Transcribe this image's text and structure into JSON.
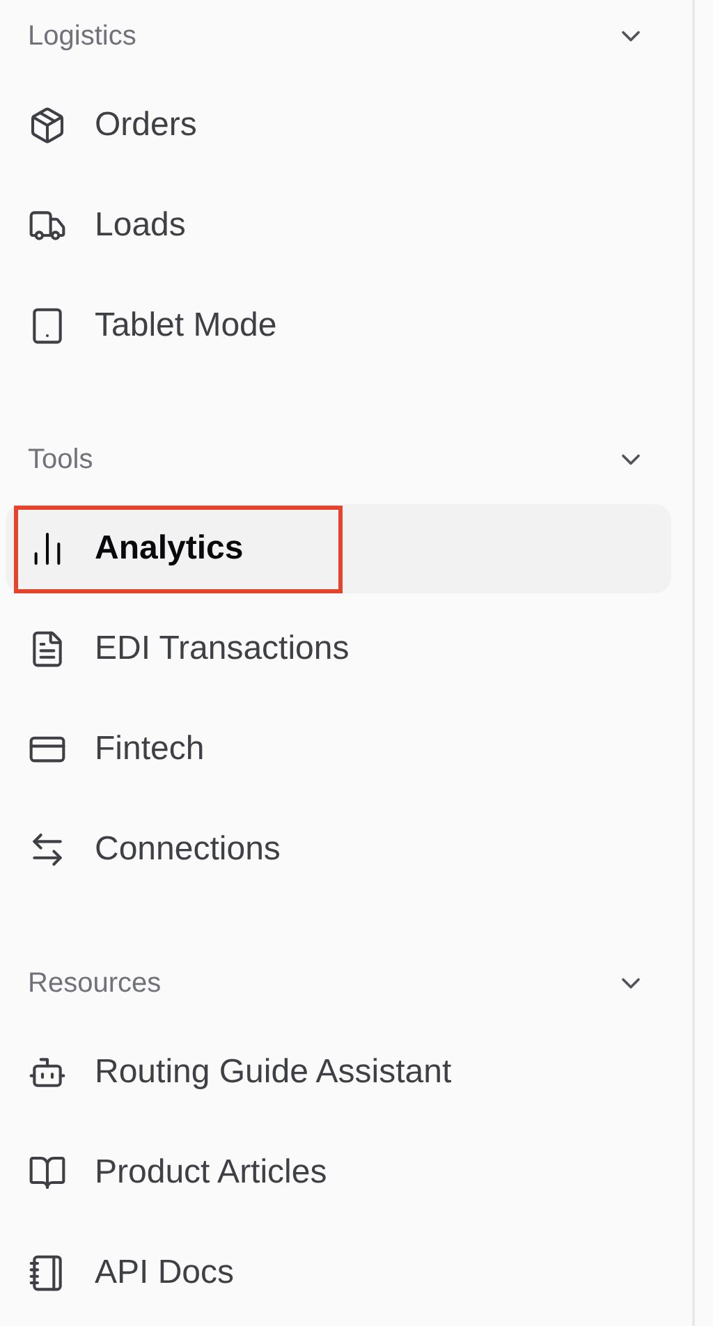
{
  "sections": [
    {
      "title": "Logistics",
      "expanded": true,
      "items": [
        {
          "label": "Orders",
          "selected": false,
          "highlighted": false
        },
        {
          "label": "Loads",
          "selected": false,
          "highlighted": false
        },
        {
          "label": "Tablet Mode",
          "selected": false,
          "highlighted": false
        }
      ]
    },
    {
      "title": "Tools",
      "expanded": true,
      "items": [
        {
          "label": "Analytics",
          "selected": true,
          "highlighted": true
        },
        {
          "label": "EDI Transactions",
          "selected": false,
          "highlighted": false
        },
        {
          "label": "Fintech",
          "selected": false,
          "highlighted": false
        },
        {
          "label": "Connections",
          "selected": false,
          "highlighted": false
        }
      ]
    },
    {
      "title": "Resources",
      "expanded": true,
      "items": [
        {
          "label": "Routing Guide Assistant",
          "selected": false,
          "highlighted": false
        },
        {
          "label": "Product Articles",
          "selected": false,
          "highlighted": false
        },
        {
          "label": "API Docs",
          "selected": false,
          "highlighted": false
        }
      ]
    }
  ]
}
